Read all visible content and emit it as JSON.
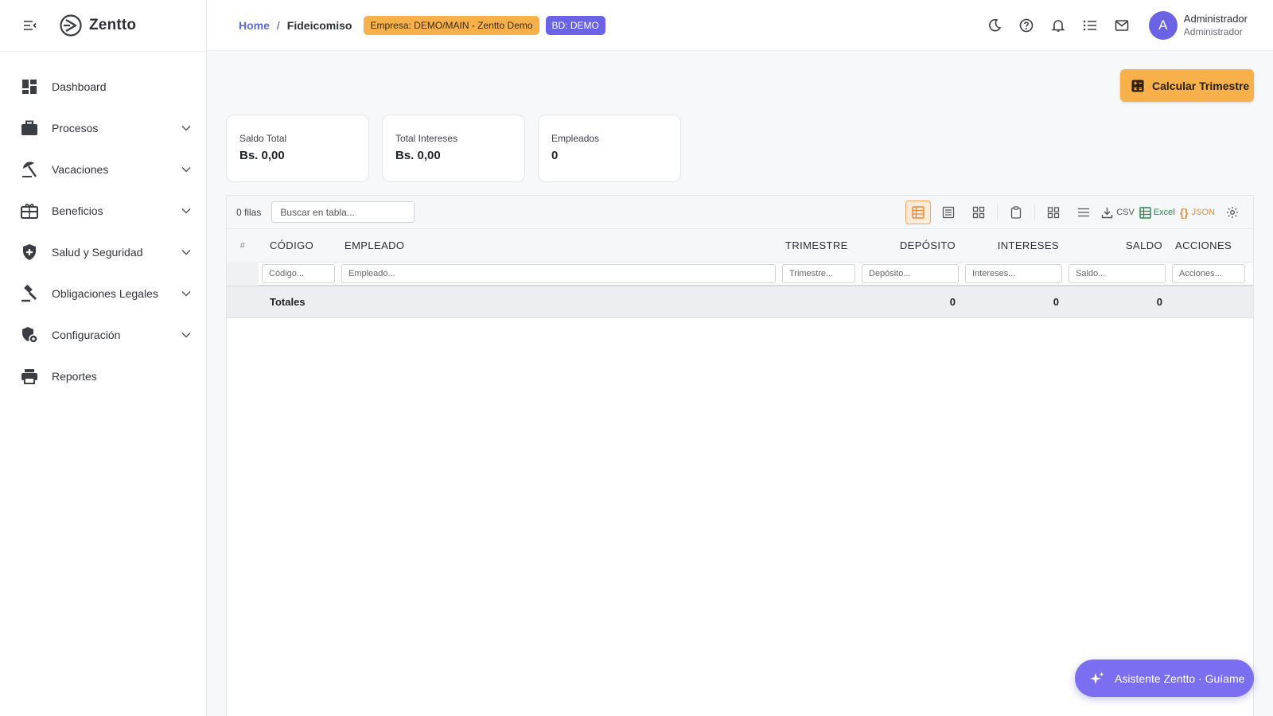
{
  "app": {
    "name": "Zentto"
  },
  "sidebar": {
    "items": [
      {
        "label": "Dashboard",
        "icon": "dashboard-icon",
        "expandable": false
      },
      {
        "label": "Procesos",
        "icon": "briefcase-icon",
        "expandable": true
      },
      {
        "label": "Vacaciones",
        "icon": "beach-umbrella-icon",
        "expandable": true
      },
      {
        "label": "Beneficios",
        "icon": "gift-box-icon",
        "expandable": true
      },
      {
        "label": "Salud y Seguridad",
        "icon": "shield-plus-icon",
        "expandable": true
      },
      {
        "label": "Obligaciones Legales",
        "icon": "gavel-icon",
        "expandable": true
      },
      {
        "label": "Configuración",
        "icon": "admin-settings-icon",
        "expandable": true
      },
      {
        "label": "Reportes",
        "icon": "printer-icon",
        "expandable": false
      }
    ]
  },
  "topbar": {
    "breadcrumb": {
      "home": "Home",
      "separator": "/",
      "current": "Fideicomiso"
    },
    "empresa_badge": "Empresa: DEMO/MAIN - Zentto Demo",
    "db_badge": "BD: DEMO",
    "user": {
      "initial": "A",
      "name": "Administrador",
      "role": "Administrador"
    }
  },
  "actions": {
    "calcular": "Calcular Trimestre"
  },
  "summary": [
    {
      "label": "Saldo Total",
      "value": "Bs. 0,00"
    },
    {
      "label": "Total Intereses",
      "value": "Bs. 0,00"
    },
    {
      "label": "Empleados",
      "value": "0"
    }
  ],
  "grid": {
    "rows_count": "0 filas",
    "search_placeholder": "Buscar en tabla...",
    "export": {
      "csv": "CSV",
      "excel": "Excel",
      "json": "JSON"
    },
    "columns": {
      "idx": "#",
      "codigo": "CÓDIGO",
      "empleado": "EMPLEADO",
      "trimestre": "TRIMESTRE",
      "deposito": "DEPÓSITO",
      "intereses": "INTERESES",
      "saldo": "SALDO",
      "acciones": "ACCIONES"
    },
    "filters": {
      "codigo": "Código...",
      "empleado": "Empleado...",
      "trimestre": "Trimestre...",
      "deposito": "Depósito...",
      "intereses": "Intereses...",
      "saldo": "Saldo...",
      "acciones": "Acciones..."
    },
    "totals": {
      "label": "Totales",
      "deposito": "0",
      "intereses": "0",
      "saldo": "0"
    }
  },
  "assistant": {
    "label": "Asistente Zentto · Guíame"
  },
  "colors": {
    "accent": "#6b63e6",
    "warning": "#f7b04a",
    "link": "#5b6bd5"
  }
}
